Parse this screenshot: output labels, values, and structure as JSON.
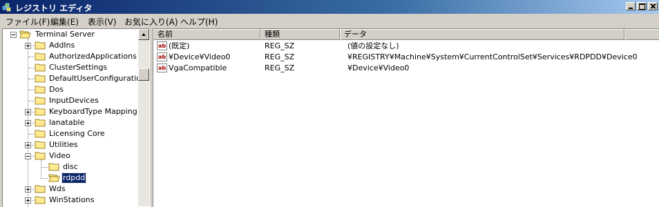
{
  "window": {
    "title": "レジストリ エディタ",
    "buttons": [
      "min",
      "max",
      "close"
    ]
  },
  "menu": [
    "ファイル(F)",
    "編集(E)",
    "表示(V)",
    "お気に入り(A)",
    "ヘルプ(H)"
  ],
  "tree": {
    "root": "Terminal Server",
    "items": [
      {
        "label": "AddIns",
        "expander": "plus"
      },
      {
        "label": "AuthorizedApplications",
        "expander": "none"
      },
      {
        "label": "ClusterSettings",
        "expander": "none"
      },
      {
        "label": "DefaultUserConfiguration",
        "expander": "none"
      },
      {
        "label": "Dos",
        "expander": "none"
      },
      {
        "label": "InputDevices",
        "expander": "none"
      },
      {
        "label": "KeyboardType Mapping",
        "expander": "plus"
      },
      {
        "label": "lanatable",
        "expander": "plus"
      },
      {
        "label": "Licensing Core",
        "expander": "none"
      },
      {
        "label": "Utilities",
        "expander": "plus"
      },
      {
        "label": "Video",
        "expander": "minus"
      },
      {
        "label": "disc",
        "child": true
      },
      {
        "label": "rdpdd",
        "child": true,
        "selected": true
      },
      {
        "label": "Wds",
        "expander": "plus"
      },
      {
        "label": "WinStations",
        "expander": "plus"
      }
    ]
  },
  "list": {
    "columns": [
      "名前",
      "種類",
      "データ"
    ],
    "rows": [
      {
        "name": "(既定)",
        "type": "REG_SZ",
        "data": "(値の設定なし)"
      },
      {
        "name": "¥Device¥Video0",
        "type": "REG_SZ",
        "data": "¥REGISTRY¥Machine¥System¥CurrentControlSet¥Services¥RDPDD¥Device0"
      },
      {
        "name": "VgaCompatible",
        "type": "REG_SZ",
        "data": "¥Device¥Video0"
      }
    ]
  },
  "icons": {
    "string_value": "ab"
  },
  "colors": {
    "titlebar_start": "#0a246a",
    "titlebar_end": "#a6caf0",
    "selection": "#0a246a",
    "folder": "#ffe98a"
  }
}
